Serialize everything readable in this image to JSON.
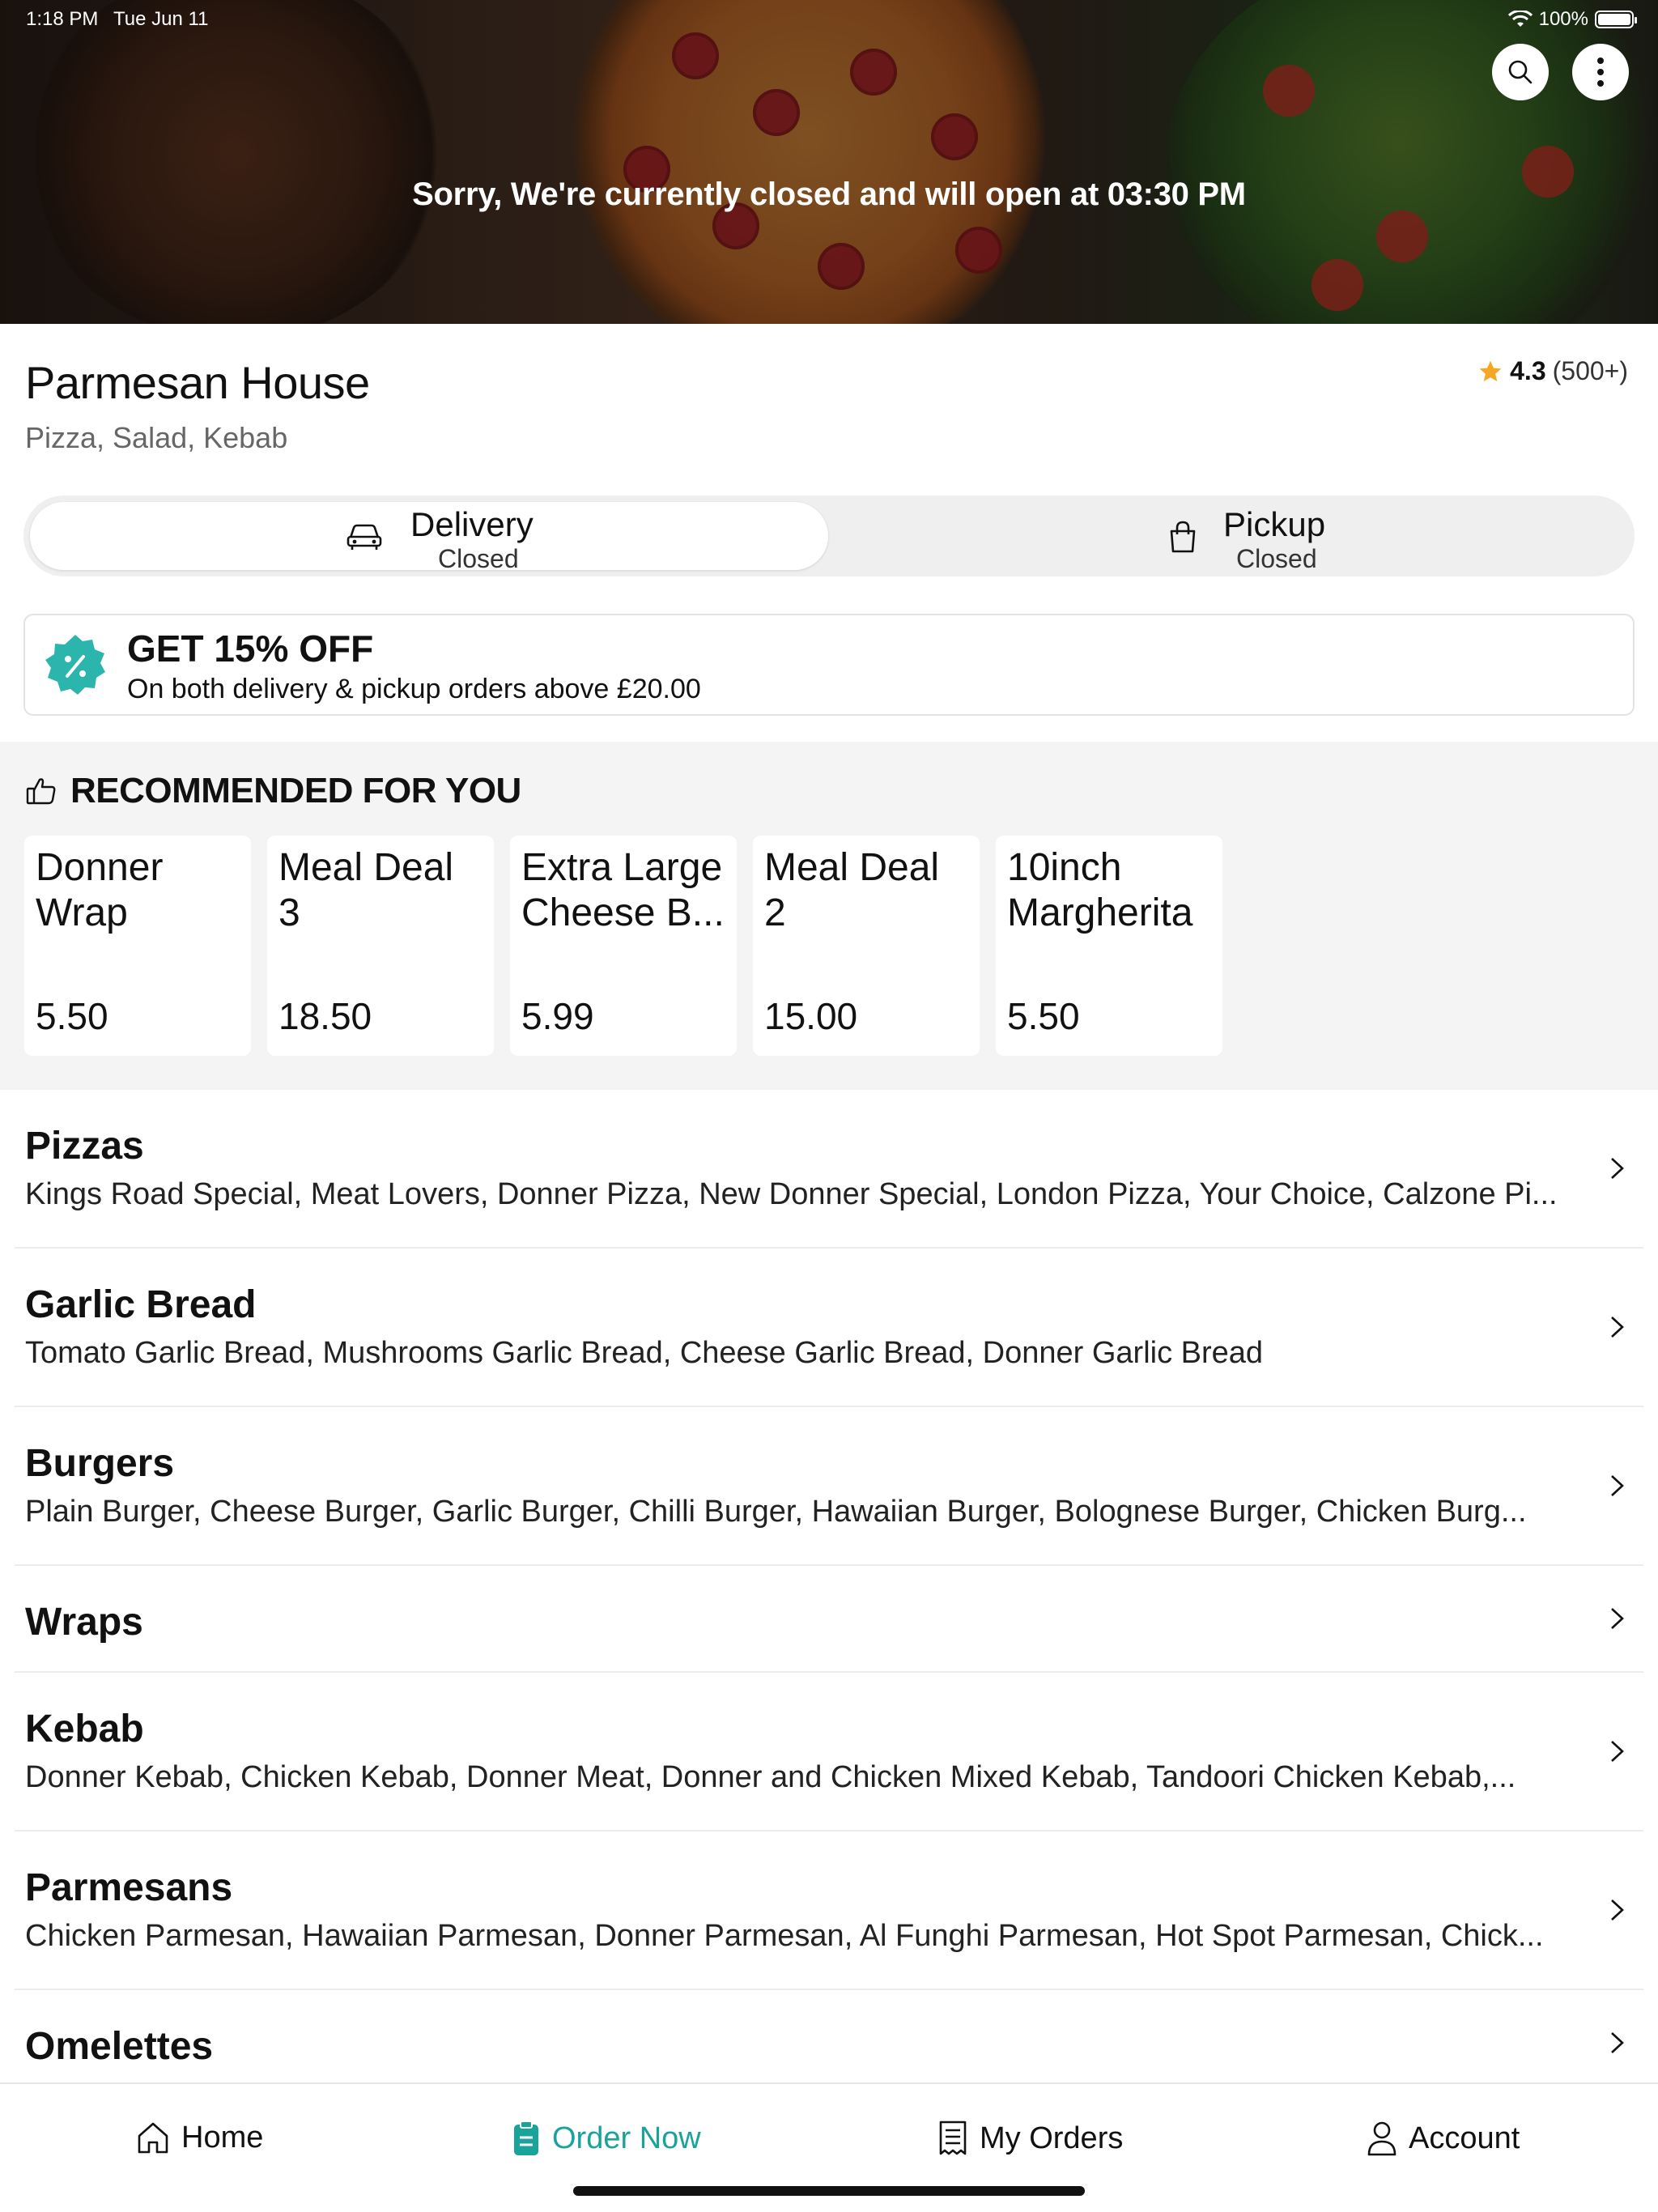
{
  "status_bar": {
    "time": "1:18 PM",
    "date": "Tue Jun 11",
    "battery": "100%",
    "battery_level": 1.0
  },
  "hero": {
    "message": "Sorry, We're currently closed and will open at 03:30 PM"
  },
  "restaurant": {
    "name": "Parmesan House",
    "cuisine": "Pizza, Salad, Kebab",
    "rating": "4.3",
    "rating_count": "(500+)"
  },
  "modes": {
    "delivery": {
      "label": "Delivery",
      "status": "Closed"
    },
    "pickup": {
      "label": "Pickup",
      "status": "Closed"
    }
  },
  "offer": {
    "title": "GET 15% OFF",
    "description": "On both delivery & pickup orders above £20.00"
  },
  "recommended": {
    "heading": "RECOMMENDED FOR YOU",
    "items": [
      {
        "name": "Donner Wrap",
        "price": "5.50"
      },
      {
        "name": "Meal Deal 3",
        "price": "18.50"
      },
      {
        "name": "Extra Large Cheese B...",
        "price": "5.99"
      },
      {
        "name": "Meal Deal 2",
        "price": "15.00"
      },
      {
        "name": "10inch Margherita",
        "price": "5.50"
      }
    ]
  },
  "categories": [
    {
      "title": "Pizzas",
      "items": "Kings Road Special, Meat Lovers, Donner Pizza, New Donner Special, London Pizza, Your Choice, Calzone Pi..."
    },
    {
      "title": "Garlic Bread",
      "items": "Tomato Garlic Bread, Mushrooms Garlic Bread, Cheese Garlic Bread, Donner Garlic Bread"
    },
    {
      "title": "Burgers",
      "items": "Plain Burger, Cheese Burger, Garlic Burger, Chilli Burger, Hawaiian Burger, Bolognese Burger, Chicken Burg..."
    },
    {
      "title": "Wraps",
      "items": ""
    },
    {
      "title": "Kebab",
      "items": "Donner Kebab, Chicken Kebab, Donner Meat, Donner and Chicken Mixed Kebab, Tandoori Chicken Kebab,..."
    },
    {
      "title": "Parmesans",
      "items": "Chicken Parmesan, Hawaiian Parmesan, Donner Parmesan, Al Funghi Parmesan, Hot Spot Parmesan, Chick..."
    },
    {
      "title": "Omelettes",
      "items": ""
    }
  ],
  "nav": {
    "home": "Home",
    "order_now": "Order Now",
    "my_orders": "My Orders",
    "account": "Account"
  },
  "colors": {
    "accent": "#1aa39a",
    "star": "#f5a623",
    "offer_badge": "#2bb5ad"
  }
}
